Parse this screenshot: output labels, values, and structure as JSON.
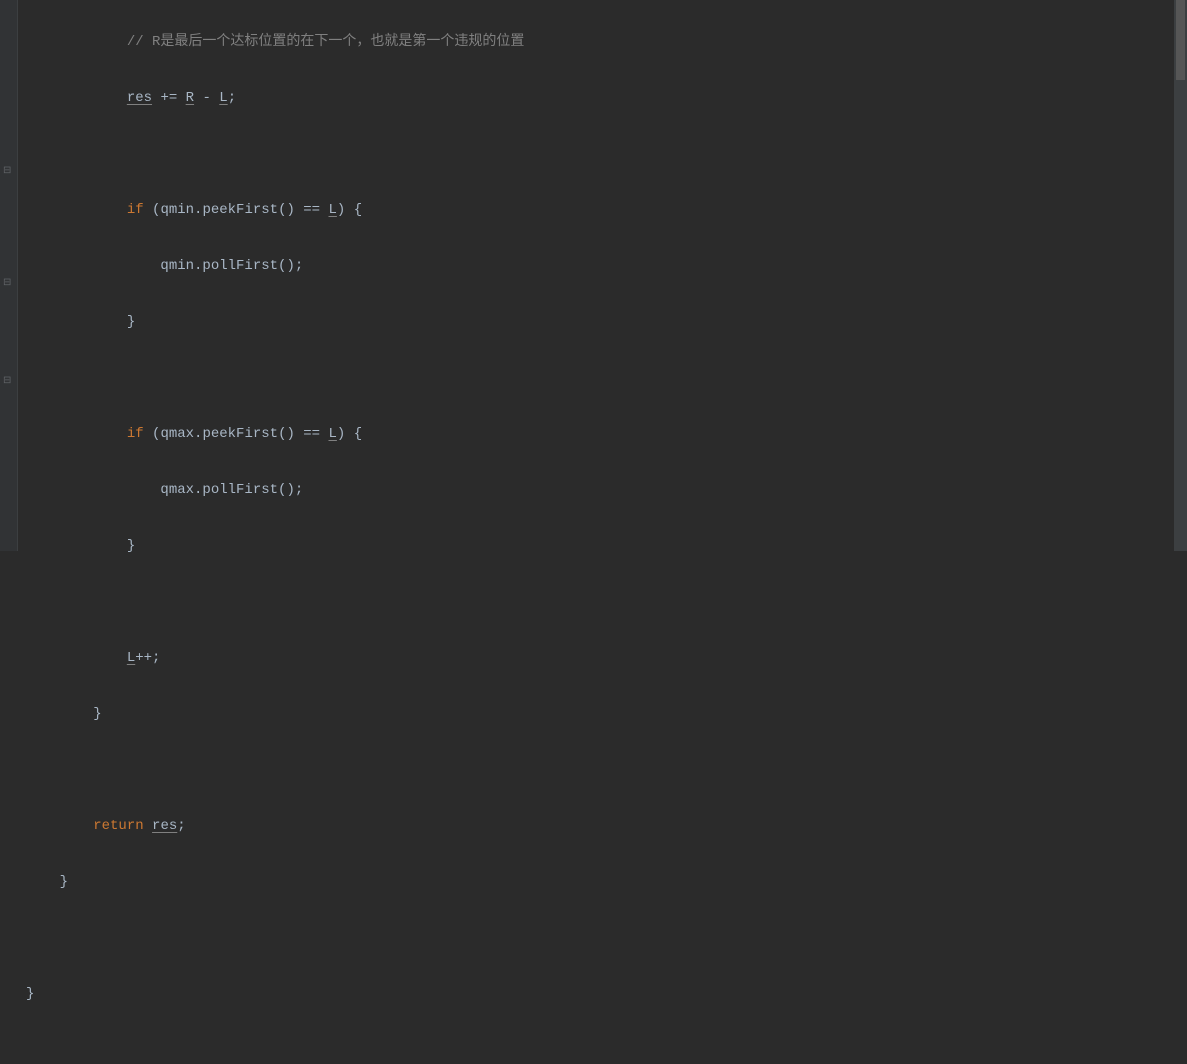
{
  "code": {
    "indent1": "        ",
    "indent2": "            ",
    "indent3": "                ",
    "line1_comment": "// R是最后一个达标位置的在下一个，也就是第一个违规的位置",
    "line2_res": "res",
    "line2_op": " += ",
    "line2_R": "R",
    "line2_minus": " - ",
    "line2_L": "L",
    "line2_semi": ";",
    "line4_if": "if",
    "line4_cond": " (qmin.peekFirst() == ",
    "line4_L": "L",
    "line4_close": ") {",
    "line5_stmt": "qmin.pollFirst();",
    "line6_brace": "}",
    "line8_if": "if",
    "line8_cond": " (qmax.peekFirst() == ",
    "line8_L": "L",
    "line8_close": ") {",
    "line9_stmt": "qmax.pollFirst();",
    "line10_brace": "}",
    "line12_L": "L",
    "line12_op": "++;",
    "line13_brace": "}",
    "line15_return": "return",
    "line15_space": " ",
    "line15_res": "res",
    "line15_semi": ";",
    "line16_brace": "}",
    "line18_brace": "}",
    "indent0": "    ",
    "indent_method": "        ",
    "indent_block": "            ",
    "indent_inner": "                "
  }
}
